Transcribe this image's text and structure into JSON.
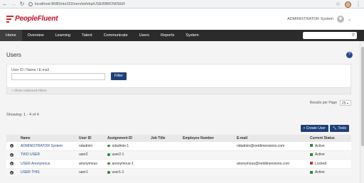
{
  "browser": {
    "url": "localhost:8080/nts152/servlet/ekp/USERBROWSER"
  },
  "header": {
    "logo_text": "PeopleFluent",
    "user_name": "ADMINISTRATOR System"
  },
  "nav": {
    "items": [
      {
        "label": "Home"
      },
      {
        "label": "Overview"
      },
      {
        "label": "Learning"
      },
      {
        "label": "Talent"
      },
      {
        "label": "Communicate"
      },
      {
        "label": "Users"
      },
      {
        "label": "Reports"
      },
      {
        "label": "System"
      }
    ]
  },
  "page": {
    "title": "Users",
    "help": "?"
  },
  "filter": {
    "label": "User ID / Name / E-mail",
    "value": "",
    "button": "Filter",
    "advanced": "+ Show Advanced Filters"
  },
  "results": {
    "per_page_label": "Results per Page",
    "per_page_value": "25",
    "showing": "Showing: 1 - 4 of 4",
    "create_user": "+ Create User",
    "tools": "Tools"
  },
  "table": {
    "headers": [
      "Name",
      "User ID",
      "Assignment ID",
      "Job Title",
      "Employee Number",
      "E-mail",
      "Current Status"
    ],
    "rows": [
      {
        "name": "ADMINISTRATOR System",
        "user_id": "ndadmin",
        "assignment_id": "ndadmin-1",
        "job_title": "",
        "employee_number": "",
        "email": "ndadmin@netdimensions.com",
        "status": "Active",
        "status_color": "#2e8b3d"
      },
      {
        "name": "TWO USER",
        "user_id": "user2",
        "assignment_id": "user2-1",
        "job_title": "",
        "employee_number": "",
        "email": "",
        "status": "Active",
        "status_color": "#2e8b3d"
      },
      {
        "name": "USER Anonymous",
        "user_id": "anonymous",
        "assignment_id": "anonymous-1",
        "job_title": "",
        "employee_number": "",
        "email": "anonymous@netdimensions.com",
        "status": "Locked",
        "status_color": "#c0392b"
      },
      {
        "name": "USER THIS",
        "user_id": "user1",
        "assignment_id": "user1-1",
        "job_title": "",
        "employee_number": "",
        "email": "",
        "status": "Active",
        "status_color": "#2e8b3d"
      }
    ]
  },
  "colors": {
    "brand_red": "#c8102e",
    "primary_blue": "#1f3f7a",
    "nav_dark": "#2b2b2b",
    "link_blue": "#2c4a8a"
  }
}
